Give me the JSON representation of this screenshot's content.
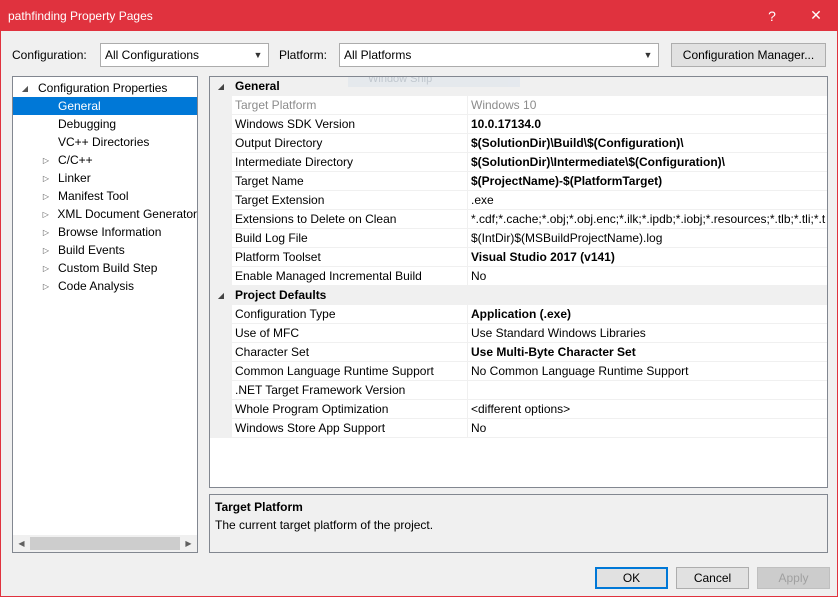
{
  "window": {
    "title": "pathfinding Property Pages",
    "help_glyph": "?",
    "close_glyph": "✕"
  },
  "toolbar": {
    "configuration_label": "Configuration:",
    "configuration_value": "All Configurations",
    "platform_label": "Platform:",
    "platform_value": "All Platforms",
    "config_manager_label": "Configuration Manager..."
  },
  "tree": {
    "root": "Configuration Properties",
    "items": [
      {
        "label": "General",
        "expandable": false
      },
      {
        "label": "Debugging",
        "expandable": false
      },
      {
        "label": "VC++ Directories",
        "expandable": false
      },
      {
        "label": "C/C++",
        "expandable": true
      },
      {
        "label": "Linker",
        "expandable": true
      },
      {
        "label": "Manifest Tool",
        "expandable": true
      },
      {
        "label": "XML Document Generator",
        "expandable": true
      },
      {
        "label": "Browse Information",
        "expandable": true
      },
      {
        "label": "Build Events",
        "expandable": true
      },
      {
        "label": "Custom Build Step",
        "expandable": true
      },
      {
        "label": "Code Analysis",
        "expandable": true
      }
    ]
  },
  "grid": {
    "ghost_label": "Window Snip",
    "sections": [
      {
        "title": "General",
        "rows": [
          {
            "name": "Target Platform",
            "value": "Windows 10"
          },
          {
            "name": "Windows SDK Version",
            "value": "10.0.17134.0"
          },
          {
            "name": "Output Directory",
            "value": "$(SolutionDir)\\Build\\$(Configuration)\\"
          },
          {
            "name": "Intermediate Directory",
            "value": "$(SolutionDir)\\Intermediate\\$(Configuration)\\"
          },
          {
            "name": "Target Name",
            "value": "$(ProjectName)-$(PlatformTarget)"
          },
          {
            "name": "Target Extension",
            "value": ".exe"
          },
          {
            "name": "Extensions to Delete on Clean",
            "value": "*.cdf;*.cache;*.obj;*.obj.enc;*.ilk;*.ipdb;*.iobj;*.resources;*.tlb;*.tli;*.t"
          },
          {
            "name": "Build Log File",
            "value": "$(IntDir)$(MSBuildProjectName).log"
          },
          {
            "name": "Platform Toolset",
            "value": "Visual Studio 2017 (v141)"
          },
          {
            "name": "Enable Managed Incremental Build",
            "value": "No"
          }
        ]
      },
      {
        "title": "Project Defaults",
        "rows": [
          {
            "name": "Configuration Type",
            "value": "Application (.exe)"
          },
          {
            "name": "Use of MFC",
            "value": "Use Standard Windows Libraries"
          },
          {
            "name": "Character Set",
            "value": "Use Multi-Byte Character Set"
          },
          {
            "name": "Common Language Runtime Support",
            "value": "No Common Language Runtime Support"
          },
          {
            "name": ".NET Target Framework Version",
            "value": ""
          },
          {
            "name": "Whole Program Optimization",
            "value": "<different options>"
          },
          {
            "name": "Windows Store App Support",
            "value": "No"
          }
        ]
      }
    ]
  },
  "description": {
    "title": "Target Platform",
    "text": "The current target platform of the project."
  },
  "buttons": {
    "ok": "OK",
    "cancel": "Cancel",
    "apply": "Apply"
  }
}
